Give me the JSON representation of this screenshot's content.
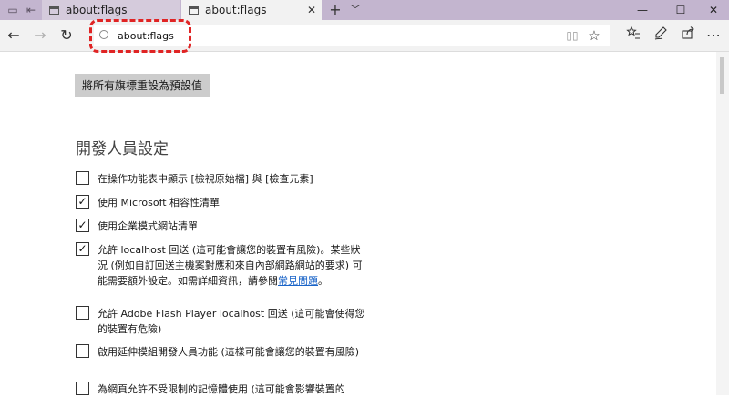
{
  "tabs": [
    {
      "title": "about:flags",
      "active": false
    },
    {
      "title": "about:flags",
      "active": true
    }
  ],
  "address": {
    "url": "about:flags"
  },
  "flags_page": {
    "reset_button": "將所有旗標重設為預設值",
    "section_title": "開發人員設定",
    "options": [
      {
        "label": "在操作功能表中顯示 [檢視原始檔] 與 [檢查元素]",
        "checked": false
      },
      {
        "label": "使用 Microsoft 相容性清單",
        "checked": true
      },
      {
        "label": "使用企業模式網站清單",
        "checked": true
      },
      {
        "label": "允許 localhost 回送 (這可能會讓您的裝置有風險)。某些狀況 (例如自訂回送主機案對應和來自內部網路網站的要求) 可能需要額外設定。如需詳細資訊，請參閱",
        "link": "常見問題",
        "tail": "。",
        "checked": true
      },
      {
        "label": "允許 Adobe Flash Player localhost 回送 (這可能會使得您的裝置有危險)",
        "checked": false
      },
      {
        "label": "啟用延伸模組開發人員功能 (這樣可能會讓您的裝置有風險)",
        "checked": false
      },
      {
        "label": "為網頁允許不受限制的記憶體使用 (這可能會影響裝置的",
        "checked": false
      }
    ]
  },
  "icons": {
    "check": "✓",
    "back": "←",
    "forward": "→",
    "refresh": "↻",
    "favorite": "☆",
    "new_tab": "+",
    "tab_menu": "﹀",
    "minimize": "—",
    "maximize": "☐",
    "close": "✕"
  },
  "colors": {
    "titlebar": "#c3b5cf",
    "highlight": "#e02424",
    "link": "#1a64c8"
  }
}
